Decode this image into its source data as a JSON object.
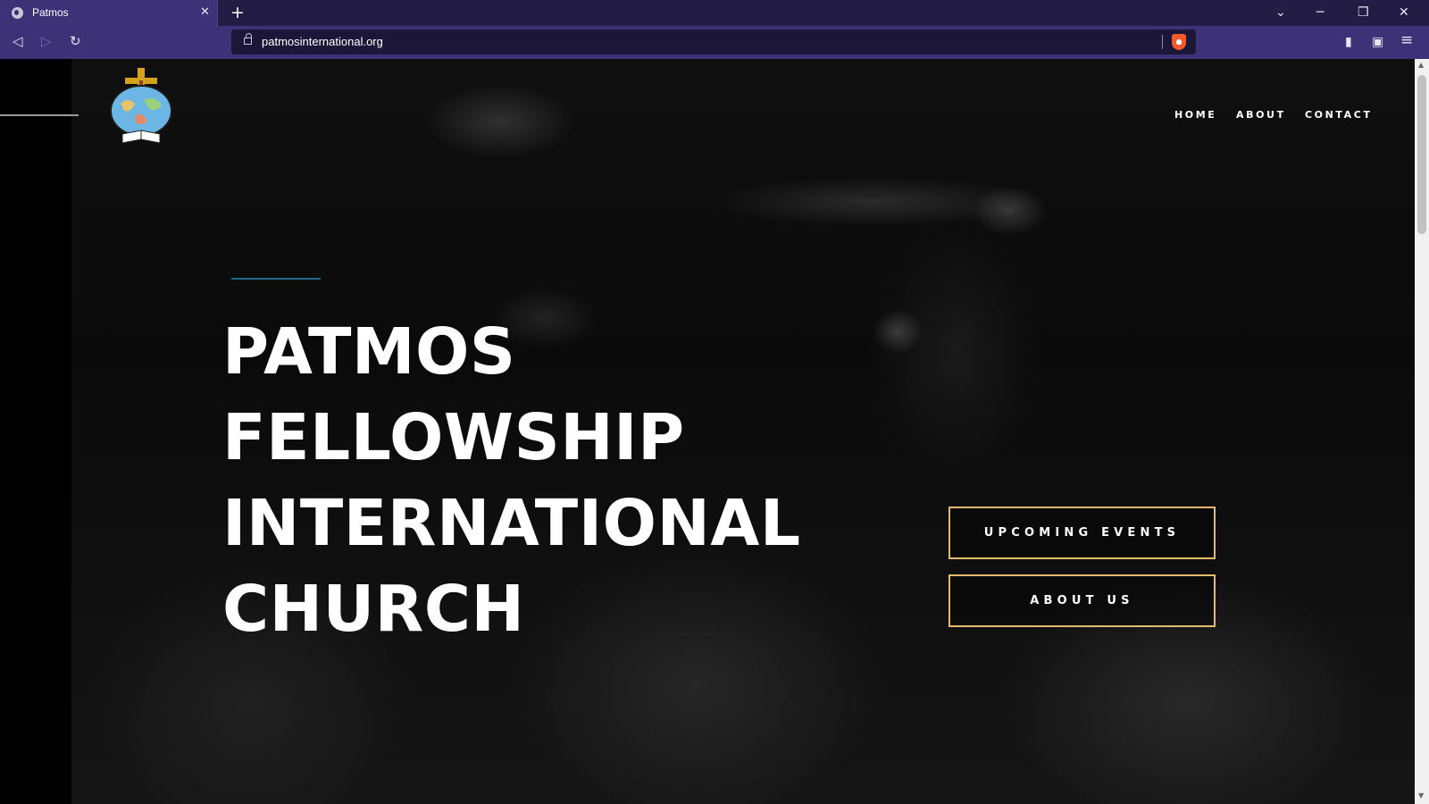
{
  "browser": {
    "tab_title": "Patmos",
    "url": "patmosinternational.org",
    "window_controls": {
      "minimize": "─",
      "restore": "❐",
      "close": "✕"
    },
    "tab_list_icon": "⌄",
    "close_tab_glyph": "✕",
    "new_tab_glyph": "+",
    "back_glyph": "◁",
    "forward_glyph": "▷",
    "reload_glyph": "↻",
    "sidebar_glyph": "▮",
    "wallet_glyph": "▣",
    "menu_glyph": "≡"
  },
  "site": {
    "nav": [
      "HOME",
      "ABOUT",
      "CONTACT"
    ],
    "hero_title_lines": [
      "PATMOS",
      "FELLOWSHIP",
      "INTERNATIONAL",
      "CHURCH"
    ],
    "buttons": {
      "upcoming_events": "UPCOMING EVENTS",
      "about_us": "ABOUT US"
    }
  },
  "colors": {
    "browser_chrome": "#3d3178",
    "cta_border": "#e6b96b",
    "accent_line": "#1f6a86"
  }
}
